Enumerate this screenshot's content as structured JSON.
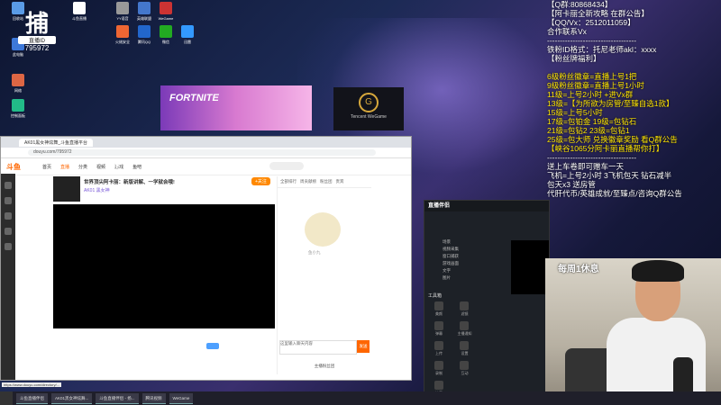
{
  "desktop": {
    "icons": [
      {
        "label": "回收站"
      },
      {
        "label": "此电脑"
      },
      {
        "label": "网络"
      },
      {
        "label": "控制面板"
      },
      {
        "label": "斗鱼直播"
      },
      {
        "label": "YY语音"
      },
      {
        "label": "英雄联盟"
      },
      {
        "label": "WeGame"
      },
      {
        "label": "火绒安全"
      },
      {
        "label": "腾讯QQ"
      },
      {
        "label": "微信"
      },
      {
        "label": "迅雷"
      }
    ],
    "logo_char": "捕",
    "logo_tag": "直播ID",
    "logo_num": "795972"
  },
  "banner": {
    "game_title": "FORTNITE",
    "game_sub": "堡垒之夜",
    "tencent": "Tencent WeGame",
    "tencent_mark": "G"
  },
  "browser": {
    "tab_title": "AK01黑女神炫舞_斗鱼直播平台",
    "url": "douyu.com/795972",
    "site_logo": "斗鱼",
    "nav": [
      "首页",
      "直播",
      "分类",
      "视频",
      "游戏",
      "鱼吧"
    ],
    "nav_active_index": 1,
    "room_title": "世界顶尖阿卡丽：新版讲解、一学就会哦!",
    "room_tag": "AK01 黑女神",
    "follow_label": "+关注",
    "side_tabs": [
      "全部排行",
      "周贡献榜",
      "粉丝团",
      "贵宾"
    ],
    "mascot_caption": "鱼小九",
    "chat_placeholder": "这里输入聊天内容",
    "send_label": "发送",
    "panel_foot": "主播粉丝团",
    "status_url": "https://www.douyu.com/directory/..."
  },
  "obs": {
    "title": "直播伴侣",
    "scene_rows": [
      "场景",
      "视频采集",
      "窗口捕获",
      "游戏画面",
      "文字",
      "图片"
    ],
    "tools_label": "工具箱",
    "tools": [
      "美颜",
      "滤镜",
      "弹幕",
      "主播通知",
      "上传",
      "设置",
      "录制",
      "互动",
      "连麦"
    ]
  },
  "overlay_lines": [
    {
      "text": "【Q群:80868434】",
      "color": "white"
    },
    {
      "text": "【阿卡丽全新攻略 在群公告】",
      "color": "white"
    },
    {
      "text": "【QQ/Vx：2512011059】",
      "color": "white"
    },
    {
      "text": "合作联系Vx",
      "color": "white"
    },
    {
      "text": "-----------------------------------",
      "color": "white"
    },
    {
      "text": "铁粉ID格式：托尼老师akl：xxxx",
      "color": "white"
    },
    {
      "text": "【粉丝牌福利】",
      "color": "white"
    },
    {
      "text": "",
      "color": "white"
    },
    {
      "text": "6级粉丝徽章=直播上号1把",
      "color": "yellow"
    },
    {
      "text": "9级粉丝徽章=直播上号1小时",
      "color": "yellow"
    },
    {
      "text": "11级=上号2小时 +进Vx群",
      "color": "yellow"
    },
    {
      "text": "13级=【为所欲为房管/至臻自选1款】",
      "color": "yellow"
    },
    {
      "text": "15级=上号5小时",
      "color": "yellow"
    },
    {
      "text": "17级=包铂金    19级=包钻石",
      "color": "yellow"
    },
    {
      "text": "21级=包钻2    23级=包钻1",
      "color": "yellow"
    },
    {
      "text": "25级=包大师  兑换徽章奖励 看Q群公告",
      "color": "yellow"
    },
    {
      "text": "【峡谷1065分阿卡丽直播帮你打】",
      "color": "yellow"
    },
    {
      "text": "-----------------------------------",
      "color": "white"
    },
    {
      "text": "送上车卷即可赠车一天",
      "color": "white"
    },
    {
      "text": "飞机=上号2小时  3飞机包天 钻石减半",
      "color": "white"
    },
    {
      "text": "包天x3 送房管",
      "color": "white"
    },
    {
      "text": "代肝代币/英雄成就/至臻点/咨询Q群公告",
      "color": "white"
    }
  ],
  "cam": {
    "label": "每周1休息"
  },
  "taskbar": {
    "tasks": [
      "斗鱼直播伴侣",
      "AK01黑女神炫舞...",
      "斗鱼直播伴侣 - 扬...",
      "腾讯视频",
      "WeGame"
    ]
  },
  "colors": {
    "accent": "#ff6600",
    "overlay_yellow": "#ffe600"
  }
}
